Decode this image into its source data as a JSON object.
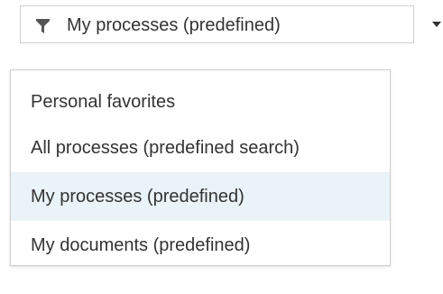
{
  "filter": {
    "icon": "filter-icon",
    "selected_label": "My processes (predefined)",
    "caret_icon": "caret-down-icon"
  },
  "dropdown": {
    "heading": "Personal favorites",
    "items": [
      {
        "label": "All processes (predefined search)"
      },
      {
        "label": "My processes (predefined)"
      },
      {
        "label": "My documents (predefined)"
      }
    ]
  },
  "colors": {
    "selected_background": "#eaf3f7",
    "border": "#cfcfcf",
    "text": "#333333"
  }
}
